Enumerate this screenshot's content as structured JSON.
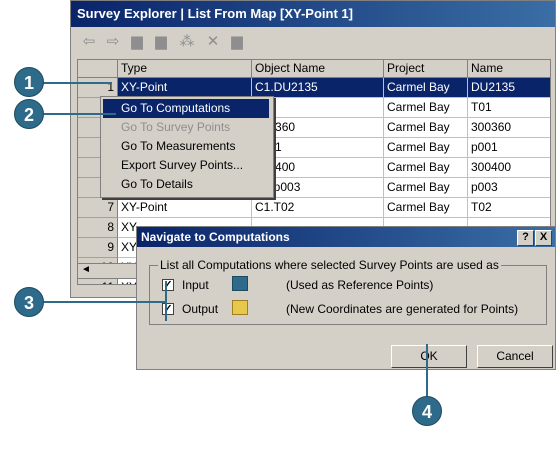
{
  "window": {
    "title": "Survey Explorer | List From Map [XY-Point 1]"
  },
  "toolbar": {
    "icons": [
      "back-arrow-icon",
      "forward-arrow-icon",
      "page-icon",
      "page-icon",
      "select-icon",
      "delete-icon",
      "page-icon"
    ],
    "glyphs": [
      "⇦",
      "⇨",
      "▆",
      "▆",
      "⁂",
      "✕",
      "▆"
    ]
  },
  "table": {
    "columns": [
      "Type",
      "Object Name",
      "Project",
      "Name"
    ],
    "rows": [
      {
        "num": "1",
        "type": "XY-Point",
        "object_name": "C1.DU2135",
        "project": "Carmel Bay",
        "name": "DU2135"
      },
      {
        "num": "2",
        "type": "",
        "object_name": "T01",
        "project": "Carmel Bay",
        "name": "T01"
      },
      {
        "num": "3",
        "type": "",
        "object_name": "300360",
        "project": "Carmel Bay",
        "name": "300360"
      },
      {
        "num": "4",
        "type": "",
        "object_name": "p001",
        "project": "Carmel Bay",
        "name": "p001"
      },
      {
        "num": "5",
        "type": "",
        "object_name": "300400",
        "project": "Carmel Bay",
        "name": "300400"
      },
      {
        "num": "6",
        "type": "XY-Point",
        "object_name": "C1.p003",
        "project": "Carmel Bay",
        "name": "p003"
      },
      {
        "num": "7",
        "type": "XY-Point",
        "object_name": "C1.T02",
        "project": "Carmel Bay",
        "name": "T02"
      },
      {
        "num": "8",
        "type": "XY-",
        "object_name": "",
        "project": "",
        "name": ""
      },
      {
        "num": "9",
        "type": "XY-",
        "object_name": "",
        "project": "",
        "name": ""
      },
      {
        "num": "10",
        "type": "XY-",
        "object_name": "",
        "project": "",
        "name": ""
      },
      {
        "num": "11",
        "type": "XY-",
        "object_name": "",
        "project": "",
        "name": ""
      }
    ]
  },
  "context_menu": {
    "items": [
      {
        "label": "Go To Computations",
        "state": "highlighted"
      },
      {
        "label": "Go To Survey Points",
        "state": "disabled"
      },
      {
        "label": "Go To Measurements",
        "state": "normal"
      },
      {
        "label": "Export Survey Points...",
        "state": "normal"
      },
      {
        "label": "Go To Details",
        "state": "normal"
      }
    ]
  },
  "dialog": {
    "title": "Navigate to Computations",
    "help_button": "?",
    "close_button": "X",
    "group_label": "List all Computations where selected Survey Points are used as",
    "input": {
      "label": "Input",
      "checked": true,
      "desc": "(Used as Reference Points)"
    },
    "output": {
      "label": "Output",
      "checked": true,
      "desc": "(New Coordinates are generated for Points)"
    },
    "ok_label": "OK",
    "cancel_label": "Cancel"
  },
  "callouts": [
    "1",
    "2",
    "3",
    "4"
  ]
}
